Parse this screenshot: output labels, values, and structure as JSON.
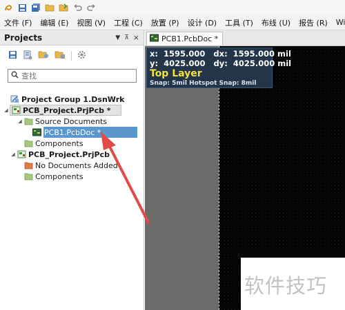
{
  "menu": [
    "文件 (F)",
    "编辑 (E)",
    "视图 (V)",
    "工程 (C)",
    "放置 (P)",
    "设计 (D)",
    "工具 (T)",
    "布线 (U)",
    "报告 (R)",
    "Window"
  ],
  "panel": {
    "title": "Projects",
    "controls": [
      "▼",
      "⊼",
      "×"
    ],
    "search_placeholder": "查找"
  },
  "tree": {
    "group": "Project Group 1.DsnWrk",
    "project1": "PCB_Project.PrjPcb *",
    "source_documents": "Source Documents",
    "pcb_doc": "PCB1.PcbDoc *",
    "components1": "Components",
    "project2": "PCB_Project.PrjPcb",
    "no_documents": "No Documents Added",
    "components2": "Components"
  },
  "document_tab": "PCB1.PcbDoc *",
  "hud": {
    "line1": "x:  1595.000   dx:  1595.000 mil",
    "line2": "y:  4025.000   dy:  4025.000 mil",
    "layer": "Top Layer",
    "snap": "Snap: 5mil Hotspot Snap: 8mil"
  },
  "watermark": "软件技巧",
  "colors": {
    "selection": "#5a97cf",
    "hud_background": "#243549",
    "layer_text": "#f5e13a",
    "annotation_arrow": "#e24a4a",
    "canvas": "#050505"
  }
}
